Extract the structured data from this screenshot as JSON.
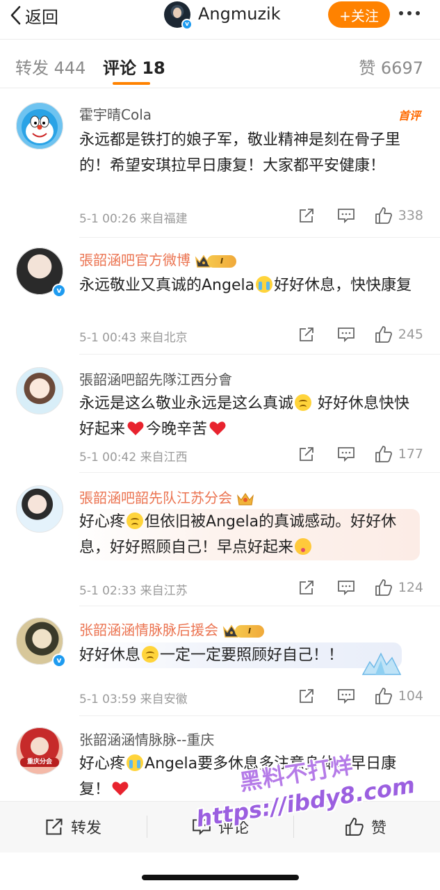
{
  "header": {
    "back_label": "返回",
    "username": "Angmuzik",
    "follow_label": "+关注"
  },
  "tabs": {
    "repost": "转发 444",
    "comment": "评论 18",
    "like": "赞 6697"
  },
  "comments": [
    {
      "name": "霍宇晴Cola",
      "tag": "首评",
      "text_parts": [
        "永远都是铁打的娘子军，敬业精神是刻在骨子里的！希望安琪拉早日康复！大家都平安健康！"
      ],
      "meta": "5-1 00:26  来自福建",
      "likes": "338"
    },
    {
      "name": "張韶涵吧官方微博",
      "badge_level": "Ⅰ",
      "text_parts": [
        "永远敬业又真诚的Angela",
        "好好休息，快快康复"
      ],
      "meta": "5-1 00:43  来自北京",
      "likes": "245"
    },
    {
      "name": "張韶涵吧韶先隊江西分會",
      "text_parts": [
        "永远是这么敬业永远是这么真诚",
        " 好好休息快快好起来",
        "今晚辛苦"
      ],
      "meta": "5-1 00:42  来自江西",
      "likes": "177"
    },
    {
      "name": "張韶涵吧韶先队江苏分会",
      "text_parts": [
        "好心疼",
        "但依旧被Angela的真诚感动。好好休息，好好照顾自己！早点好起来"
      ],
      "meta": "5-1 02:33  来自江苏",
      "likes": "124"
    },
    {
      "name": "张韶涵涵情脉脉后援会",
      "badge_level": "Ⅰ",
      "text_parts": [
        "好好休息",
        "一定一定要照顾好自己！！"
      ],
      "meta": "5-1 03:59  来自安徽",
      "likes": "104"
    },
    {
      "name": "张韶涵涵情脉脉--重庆",
      "avatar_label": "重庆分会",
      "text_parts": [
        "好心疼",
        "Angela要多休息多注意身体，早日康复！"
      ]
    }
  ],
  "bottom_bar": {
    "repost": "转发",
    "comment": "评论",
    "like": "赞"
  },
  "watermark": {
    "line1": "黑料不打烊",
    "line2": "https://ibdy8.com"
  },
  "colors": {
    "accent": "#ff8200",
    "vip_name": "#eb7350",
    "verified": "#1e9bf0"
  }
}
